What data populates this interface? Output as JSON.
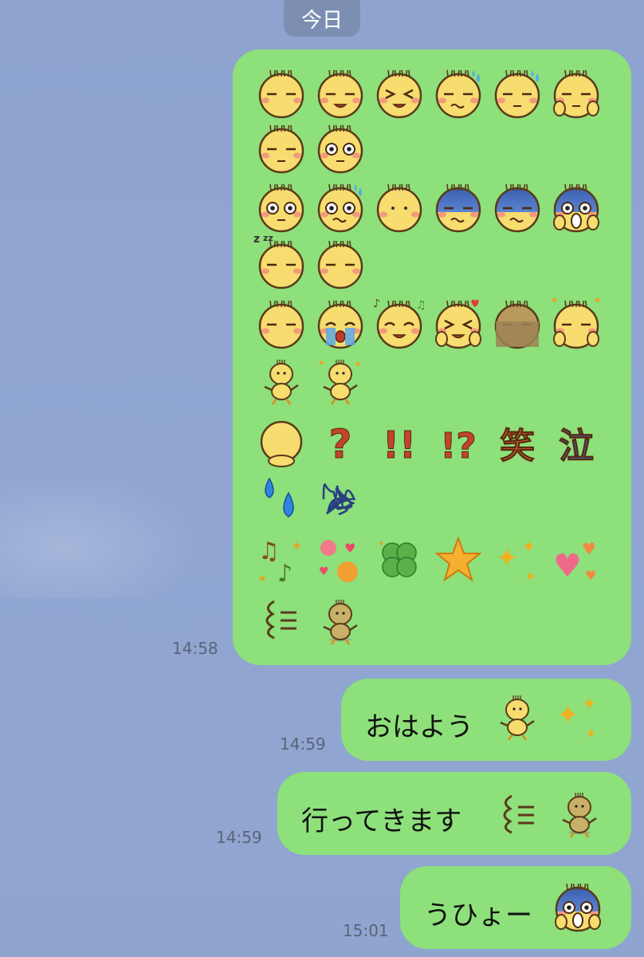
{
  "header": {
    "date_label": "今日"
  },
  "messages": [
    {
      "id": "m1",
      "type": "emoji-grid",
      "time": "14:58",
      "rows": [
        [
          "face-neutral",
          "face-smile",
          "face-laugh",
          "face-sweat",
          "face-sweat-drops",
          "face-thumb"
        ],
        [
          "face-salute",
          "face-eyes"
        ],
        [
          "face-shocked",
          "face-shocked-drop",
          "face-dot",
          "face-blue-gloom",
          "face-blue-meh",
          "face-blue-scream"
        ],
        [
          "face-sleep",
          "face-plain"
        ],
        [
          "face-content",
          "face-cry",
          "face-music",
          "face-wink-heart",
          "face-dark",
          "face-sparkle"
        ],
        [
          "chick-dance",
          "chick-dance-sparkle"
        ],
        [
          "face-back",
          "question-mark",
          "double-exclamation",
          "exclamation-question",
          "laugh-kanji",
          "cry-kanji"
        ],
        [
          "water-drops",
          "scribble"
        ],
        [
          "music-notes",
          "flowers-hearts",
          "clover",
          "star",
          "sparkles",
          "hearts"
        ],
        [
          "dash-wind",
          "chick-run"
        ]
      ]
    },
    {
      "id": "m2",
      "type": "text",
      "time": "14:59",
      "text": "おはよう"
    },
    {
      "id": "m3",
      "type": "text",
      "time": "14:59",
      "text": "行ってきます"
    },
    {
      "id": "m4",
      "type": "text",
      "time": "15:01",
      "text": "うひょー"
    }
  ],
  "kanji": {
    "laugh": "笑",
    "cry": "泣"
  },
  "symbols": {
    "question": "?",
    "double_exclamation": "!!",
    "exclamation_question": "!?"
  },
  "colors": {
    "bubble": "#8de07a",
    "background": "#8fa5d0",
    "date_pill": "#7c8fb3"
  }
}
